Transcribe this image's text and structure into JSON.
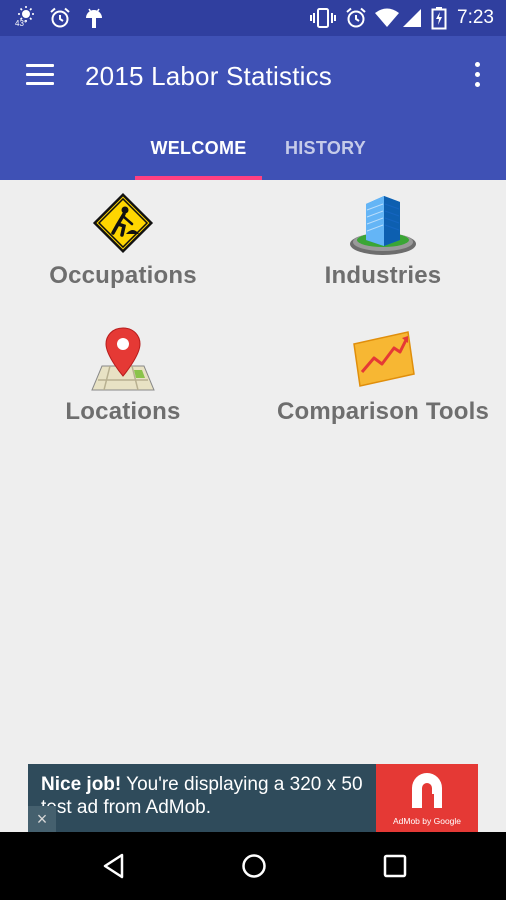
{
  "status_bar": {
    "time": "7:23",
    "weather_temp": "43°",
    "left_icons": [
      "weather-icon",
      "alarm-icon",
      "android-icon"
    ],
    "right_icons": [
      "vibrate-icon",
      "alarm-icon",
      "wifi-icon",
      "signal-icon",
      "battery-charging-icon"
    ]
  },
  "app_bar": {
    "title": "2015 Labor Statistics",
    "menu_icon": "hamburger-menu-icon",
    "overflow_icon": "more-vert-icon",
    "color": "#3f51b5",
    "status_color": "#303f9f"
  },
  "tabs": [
    {
      "label": "WELCOME",
      "selected": true
    },
    {
      "label": "HISTORY",
      "selected": false
    }
  ],
  "tab_indicator_color": "#ff4081",
  "categories": [
    {
      "label": "Occupations",
      "icon": "road-work-sign-icon"
    },
    {
      "label": "Industries",
      "icon": "office-building-icon"
    },
    {
      "label": "Locations",
      "icon": "map-pin-icon"
    },
    {
      "label": "Comparison Tools",
      "icon": "growth-chart-icon"
    }
  ],
  "ad": {
    "bold": "Nice job!",
    "text": " You're displaying a 320 x 50 test ad from AdMob.",
    "logo_caption": "AdMob by Google",
    "close": "×",
    "logo_color": "#e53935"
  },
  "nav_bar": {
    "buttons": [
      "back-icon",
      "home-icon",
      "recents-icon"
    ]
  }
}
